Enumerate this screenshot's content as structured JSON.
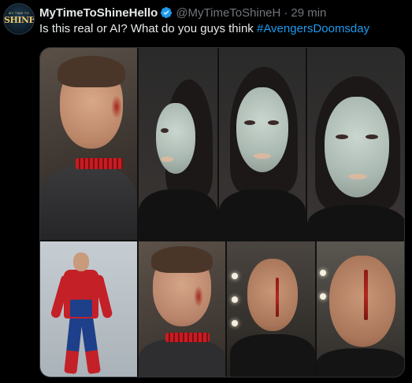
{
  "post": {
    "avatar_text_top": "MY TIME TO",
    "avatar_text_main": "SHINE",
    "display_name": "MyTimeToShineHello",
    "handle": "@MyTimeToShineH",
    "separator": "·",
    "time": "29 min",
    "text": "Is this real or AI? What do you guys think ",
    "hashtag": "#AvengersDoomsday"
  },
  "colors": {
    "background": "#000000",
    "text_primary": "#e7e9ea",
    "text_secondary": "#71767b",
    "link": "#1d9bf0",
    "verified": "#1d9bf0",
    "border": "#2f3336"
  },
  "media": {
    "icons": [
      "verified-badge-icon"
    ]
  }
}
